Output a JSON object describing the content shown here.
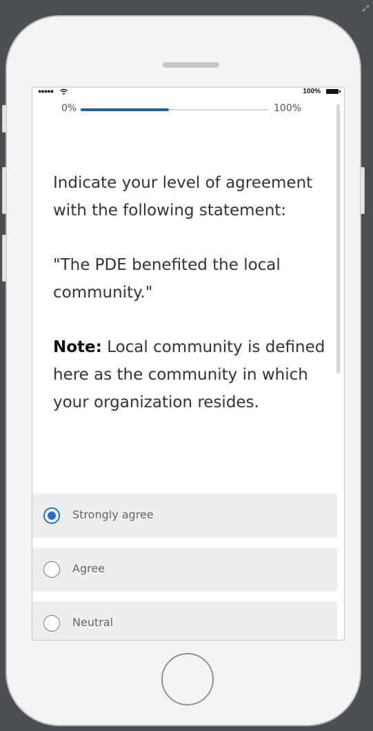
{
  "status_bar": {
    "signal": "●●●●●",
    "wifi_icon": "wifi-icon",
    "battery_percent": "100%",
    "battery_icon": "battery-icon"
  },
  "progress": {
    "start_label": "0%",
    "end_label": "100%",
    "fraction": 0.47,
    "color": "#1e5fa8"
  },
  "question": {
    "prompt": "Indicate your level of agreement with the following statement:",
    "statement": "\"The PDE benefited the local community.\"",
    "note_label": "Note:",
    "note_text": " Local community is defined here as the community in which your organization resides."
  },
  "options": [
    {
      "label": "Strongly agree",
      "selected": true
    },
    {
      "label": "Agree",
      "selected": false
    },
    {
      "label": "Neutral",
      "selected": false
    }
  ],
  "colors": {
    "accent": "#1e6fd0",
    "background": "#4a4f54",
    "phone_body": "#f4f4f4"
  }
}
